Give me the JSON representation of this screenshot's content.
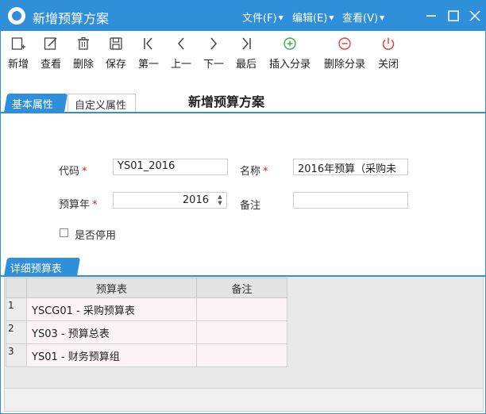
{
  "window": {
    "title": "新增预算方案"
  },
  "menu": [
    {
      "label": "文件(F)"
    },
    {
      "label": "编辑(E)"
    },
    {
      "label": "查看(V)"
    }
  ],
  "toolbar": [
    {
      "label": "新增",
      "icon": "new-icon"
    },
    {
      "label": "查看",
      "icon": "edit-icon"
    },
    {
      "label": "删除",
      "icon": "trash-icon"
    },
    {
      "label": "保存",
      "icon": "save-icon"
    },
    {
      "label": "第一",
      "icon": "first-icon"
    },
    {
      "label": "上一",
      "icon": "prev-icon"
    },
    {
      "label": "下一",
      "icon": "next-icon"
    },
    {
      "label": "最后",
      "icon": "last-icon"
    },
    {
      "label": "插入分录",
      "icon": "plus-circle-icon"
    },
    {
      "label": "删除分录",
      "icon": "minus-circle-icon"
    },
    {
      "label": "关闭",
      "icon": "power-icon"
    }
  ],
  "colors": {
    "accent": "#2f8fd8",
    "green": "#3aae4c",
    "red": "#e04040",
    "required": "#d02020"
  },
  "tabs": [
    {
      "label": "基本属性"
    },
    {
      "label": "自定义属性"
    }
  ],
  "form_title": "新增预算方案",
  "form": {
    "code_label": "代码",
    "code_value": "YS01_2016",
    "name_label": "名称",
    "name_value": "2016年预算（采购未",
    "year_label": "预算年",
    "year_value": "2016",
    "remark_label": "备注",
    "remark_value": "",
    "required_mark": "*",
    "disabled_label": "是否停用"
  },
  "detail": {
    "tab_label": "详细预算表",
    "columns": [
      "预算表",
      "备注"
    ],
    "rows": [
      {
        "num": "1",
        "budget": "YSCG01 - 采购预算表",
        "remark": ""
      },
      {
        "num": "2",
        "budget": "YS03 - 预算总表",
        "remark": ""
      },
      {
        "num": "3",
        "budget": "YS01 - 财务预算组",
        "remark": ""
      }
    ]
  }
}
